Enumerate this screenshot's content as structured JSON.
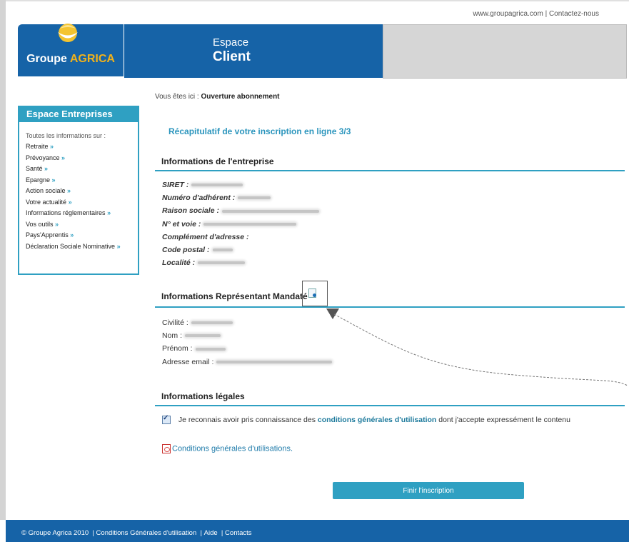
{
  "header": {
    "links": [
      "www.groupagrica.com",
      "Contactez-nous"
    ],
    "separator": "|",
    "logo_text_part1": "Groupe",
    "logo_text_part2": "AGRICA",
    "espace_line1": "Espace",
    "espace_line2": "Client"
  },
  "sidebar": {
    "title": "Espace Entreprises",
    "intro": "Toutes les informations sur :",
    "items": [
      {
        "label": "Retraite",
        "arrow": "»"
      },
      {
        "label": "Prévoyance",
        "arrow": "»"
      },
      {
        "label": "Santé",
        "arrow": "»"
      },
      {
        "label": "Epargne",
        "arrow": "»"
      },
      {
        "label": "Action sociale",
        "arrow": "»"
      },
      {
        "label": "Votre actualité",
        "arrow": "»"
      },
      {
        "label": "Informations réglementaires",
        "arrow": "»"
      },
      {
        "label": "Vos outils",
        "arrow": "»"
      },
      {
        "label": "Pays'Apprentis",
        "arrow": "»"
      },
      {
        "label": "Déclaration Sociale Nominative",
        "arrow": "»"
      }
    ]
  },
  "breadcrumb": {
    "prefix": "Vous êtes ici :",
    "current": "Ouverture abonnement"
  },
  "main": {
    "title": "Récapitulatif de votre inscription en ligne 3/3",
    "company_section": "Informations de l'entreprise",
    "company_fields": [
      "SIRET :",
      "Numéro d'adhérent :",
      "Raison sociale :",
      "N° et voie :",
      "Complément d'adresse :",
      "Code postal :",
      "Localité :"
    ],
    "rep_section": "Informations Représentant Mandaté",
    "rep_fields": [
      "Civilité :",
      "Nom :",
      "Prénom :",
      "Adresse email :"
    ],
    "legal_section": "Informations légales",
    "legal_text_before": "Je reconnais avoir pris connaissance des",
    "legal_link": "conditions générales d'utilisation",
    "legal_text_after": "dont j'accepte expressément le contenu",
    "legal_checked": true,
    "pdf_link": "Conditions générales d'utilisations.",
    "finish_button": "Finir l'inscription"
  },
  "footer": {
    "copyright": "© Groupe Agrica 2010",
    "links": [
      "Conditions Générales d'utilisation",
      "Aide",
      "Contacts"
    ]
  },
  "colors": {
    "brand_blue": "#1663a7",
    "accent_cyan": "#2fa0c2",
    "logo_gold": "#f2b21a"
  }
}
